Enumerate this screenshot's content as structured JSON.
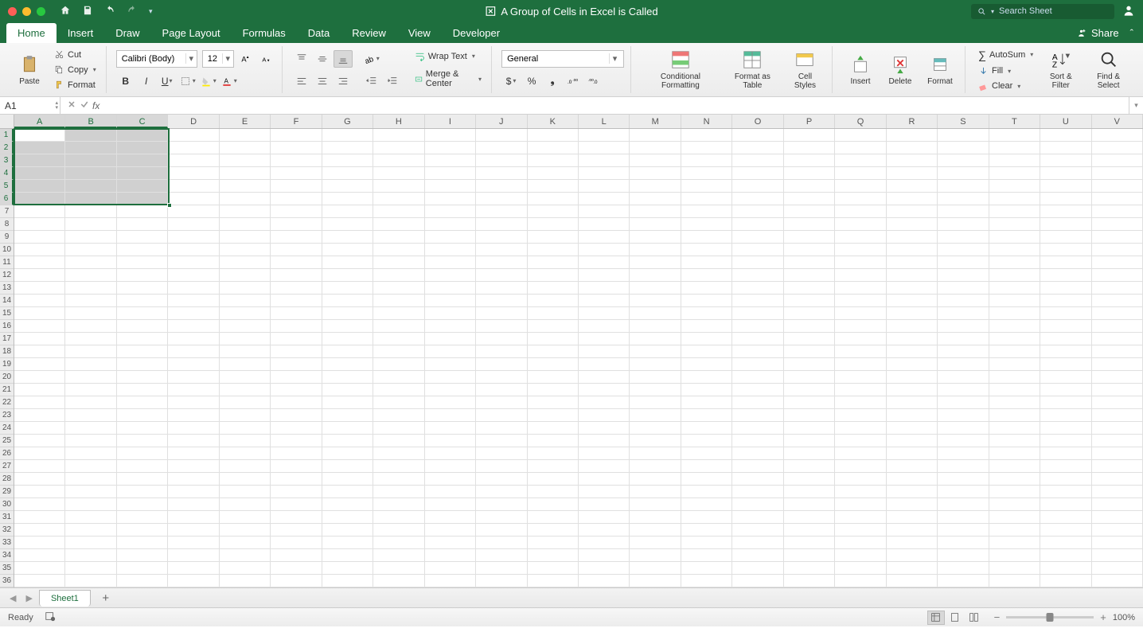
{
  "title": "A Group of Cells in Excel is Called",
  "search_placeholder": "Search Sheet",
  "tabs": [
    "Home",
    "Insert",
    "Draw",
    "Page Layout",
    "Formulas",
    "Data",
    "Review",
    "View",
    "Developer"
  ],
  "active_tab": "Home",
  "share_label": "Share",
  "clipboard": {
    "paste": "Paste",
    "cut": "Cut",
    "copy": "Copy",
    "format": "Format"
  },
  "font": {
    "name": "Calibri (Body)",
    "size": "12"
  },
  "alignment": {
    "wrap": "Wrap Text",
    "merge": "Merge & Center"
  },
  "number_format": "General",
  "styles": {
    "cf": "Conditional Formatting",
    "fat": "Format as Table",
    "cs": "Cell Styles"
  },
  "cells": {
    "insert": "Insert",
    "delete": "Delete",
    "format": "Format"
  },
  "editing": {
    "autosum": "AutoSum",
    "fill": "Fill",
    "clear": "Clear",
    "sort": "Sort & Filter",
    "find": "Find & Select"
  },
  "name_box": "A1",
  "columns": [
    "A",
    "B",
    "C",
    "D",
    "E",
    "F",
    "G",
    "H",
    "I",
    "J",
    "K",
    "L",
    "M",
    "N",
    "O",
    "P",
    "Q",
    "R",
    "S",
    "T",
    "U",
    "V"
  ],
  "rows": 36,
  "selected_cols": [
    "A",
    "B",
    "C"
  ],
  "selected_rows": [
    1,
    2,
    3,
    4,
    5,
    6
  ],
  "active_cell": "A1",
  "sheet_name": "Sheet1",
  "status_text": "Ready",
  "zoom": "100%"
}
